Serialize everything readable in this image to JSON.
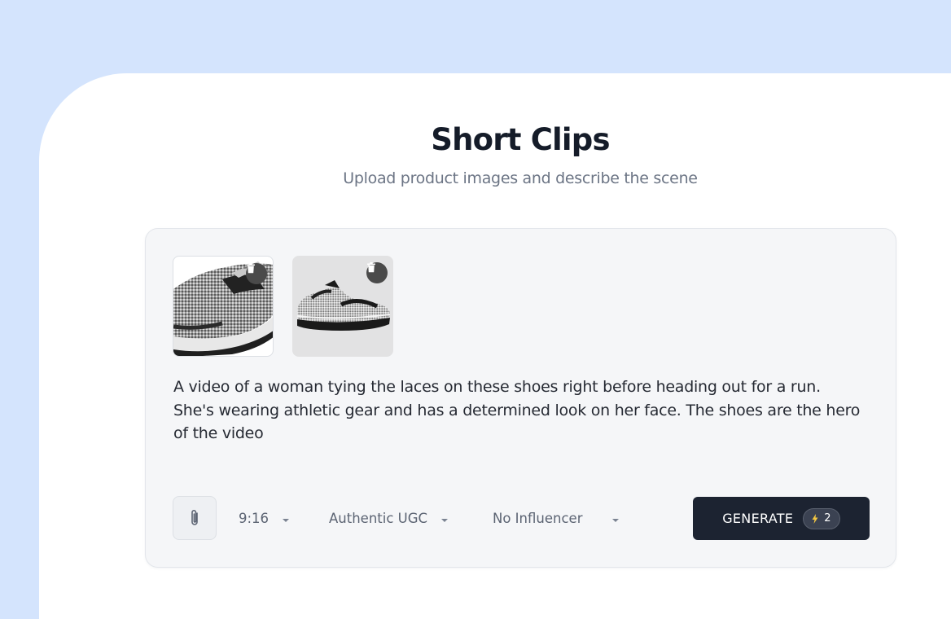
{
  "header": {
    "title": "Short Clips",
    "subtitle": "Upload product images and describe the scene"
  },
  "uploads": [
    {
      "name": "product-image-1",
      "icon": "trash-icon"
    },
    {
      "name": "product-image-2",
      "icon": "trash-icon"
    }
  ],
  "prompt": {
    "text": "A video of a woman tying the laces on these shoes right before heading out for a run. She's wearing athletic gear and has a determined look on her face. The shoes are the hero of the video"
  },
  "toolbar": {
    "attach_icon": "paperclip-icon",
    "aspect_ratio": "9:16",
    "style": "Authentic UGC",
    "influencer": "No Influencer",
    "generate_label": "GENERATE",
    "credits": "2",
    "credit_icon": "lightning-icon"
  },
  "colors": {
    "background": "#d4e4fd",
    "button": "#1c2331",
    "accent_lightning": "#f5c842"
  }
}
